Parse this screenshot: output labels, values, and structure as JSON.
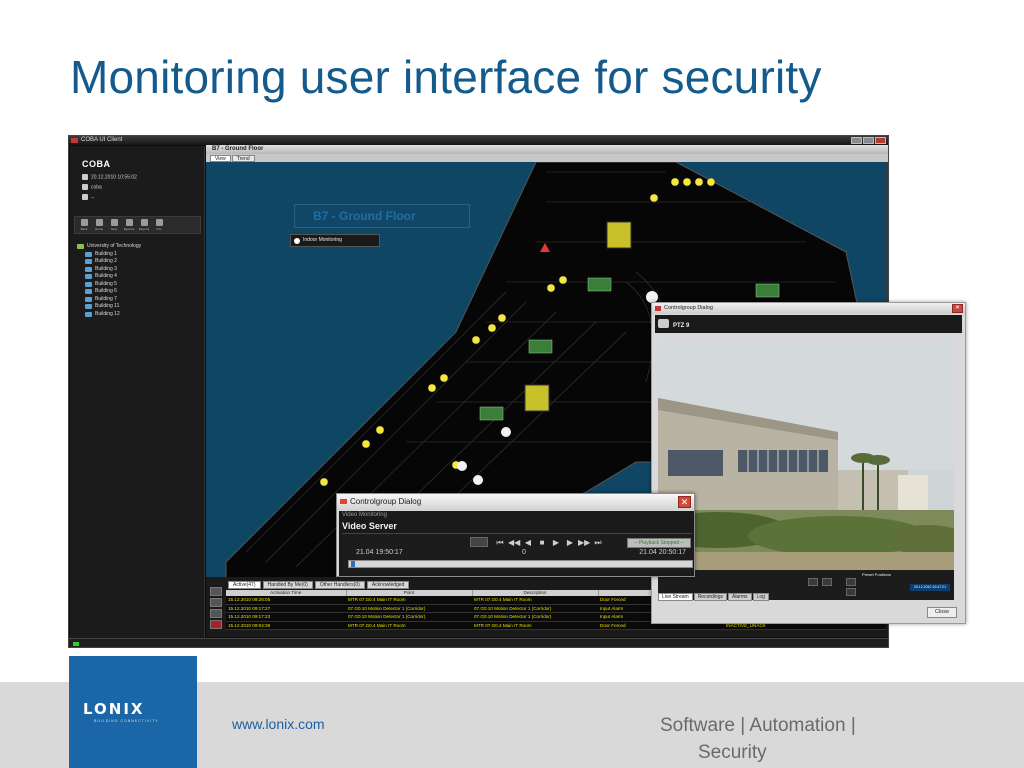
{
  "slide": {
    "title": "Monitoring user interface for security",
    "footer_url": "www.lonix.com",
    "tagline_line1": "Software | Automation |",
    "tagline_line2": "Security",
    "logo_text": "LONIX",
    "logo_tagline": "BUILDING CONNECTIVITY"
  },
  "colors": {
    "title": "#145a8c",
    "map_background": "#0f4664",
    "alarm_text": "#e8e200",
    "logo_box": "#1a66a6"
  },
  "app": {
    "window_title": "COBA UI Client",
    "logo": "COBA",
    "logo_suffix": "",
    "info": {
      "datetime": "20.12.2010 10:55:02",
      "user": "coba",
      "extra": "--"
    },
    "toolbar": [
      {
        "label": "Back",
        "icon": "arrow-left-icon"
      },
      {
        "label": "Home",
        "icon": "home-icon"
      },
      {
        "label": "Next",
        "icon": "arrow-right-icon"
      },
      {
        "label": "Reports",
        "icon": "report-icon"
      },
      {
        "label": "Reports",
        "icon": "info-icon"
      },
      {
        "label": "Info",
        "icon": "hand-icon"
      }
    ],
    "tree": {
      "root": "University of Technology",
      "items": [
        "Building 1",
        "Building 2",
        "Building 3",
        "Building 4",
        "Building 5",
        "Building 6",
        "Building 7",
        "Building 11",
        "Building 12"
      ]
    },
    "map": {
      "header": "B7 - Ground Floor",
      "tabs": [
        "View",
        "Trend"
      ],
      "floor_label": "B7 - Ground Floor",
      "legend": "Indoor Monitoring"
    },
    "alarms": {
      "tabs": [
        "Active(47)",
        "Handled By Me(0)",
        "Other Handlers(0)",
        "Acknowledged"
      ],
      "columns": [
        "Activation Time",
        "Point",
        "Description",
        "",
        ""
      ],
      "rows": [
        [
          "15.12.2010 09:26:05",
          "MTR 07.G0.4 Main IT Room",
          "MTR 07.G0.4 Main IT Room",
          "Door Forced",
          ""
        ],
        [
          "15.12.2010 09:17:27",
          "07.G0.10 Motion Detector 1 (Corridor)",
          "07.G0.10 Motion Detector 1 (Corridor)",
          "Input Alarm",
          ""
        ],
        [
          "15.12.2010 09:17:23",
          "07.G0.10 Motion Detector 1 (Corridor)",
          "07.G0.10 Motion Detector 1 (Corridor)",
          "Input Alarm",
          ""
        ],
        [
          "15.12.2010 09:04:39",
          "MTR 07.G0.4 Main IT Room",
          "MTR 07.G0.4 Main IT Room",
          "Door Forced",
          "INACTIVE_UNACK"
        ]
      ]
    }
  },
  "ptz_dialog": {
    "title": "Controlgroup Dialog",
    "subtitle": "",
    "camera_name": "PTZ 9",
    "preset_title": "Preset Positions",
    "date": "20.12.2010 10:47:21",
    "tabs": [
      "Live Stream",
      "Recordings",
      "Alarms",
      "Log"
    ],
    "close_label": "Close"
  },
  "video_dialog": {
    "title": "Controlgroup Dialog",
    "subtitle": "Video Monitoring",
    "name": "Video Server",
    "status": "-- Playback Stopped --",
    "time_start": "21.04 19:50:17",
    "time_mid": "0",
    "time_end": "21.04 20:50:17"
  }
}
